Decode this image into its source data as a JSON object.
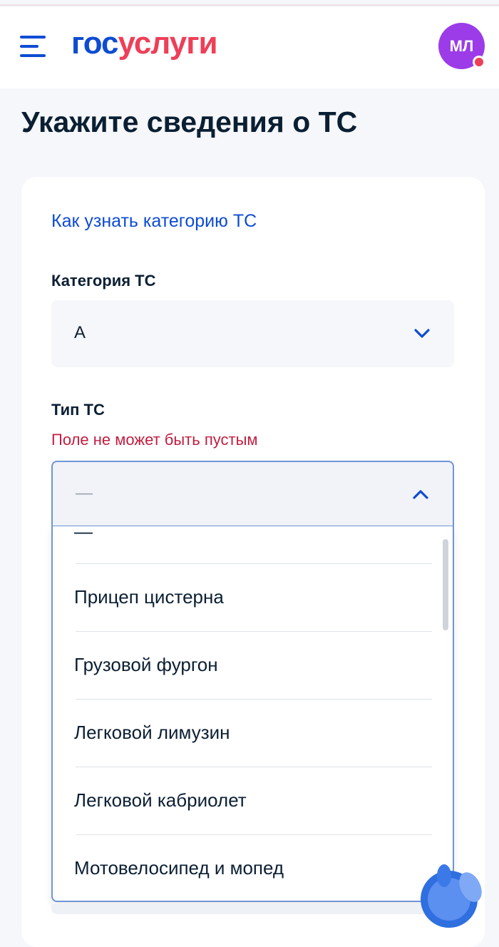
{
  "header": {
    "logo_part1": "гос",
    "logo_part2": "услуги",
    "avatar_initials": "МЛ"
  },
  "page": {
    "title": "Укажите сведения о ТС"
  },
  "form": {
    "help_link": "Как узнать категорию ТС",
    "category": {
      "label": "Категория ТС",
      "value": "A"
    },
    "type": {
      "label": "Тип ТС",
      "error": "Поле не может быть пустым",
      "value": "—",
      "options": [
        "—",
        "Прицеп цистерна",
        "Грузовой фургон",
        "Легковой лимузин",
        "Легковой кабриолет",
        "Мотовелосипед и мопед"
      ]
    }
  },
  "colors": {
    "brand_blue": "#0d4cd3",
    "brand_red": "#ee3f58",
    "error_red": "#c21e40",
    "avatar_purple": "#9b3ce8"
  },
  "icons": [
    "menu-icon",
    "chevron-down-icon",
    "chevron-up-icon",
    "assistant-icon"
  ]
}
